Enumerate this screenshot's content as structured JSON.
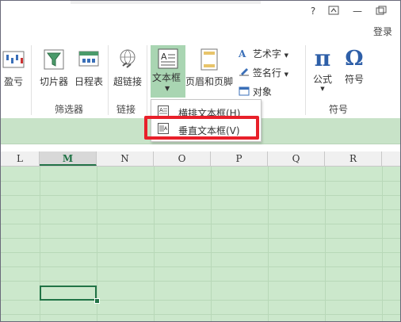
{
  "window": {
    "help_label": "?",
    "restore_label": "⧉",
    "minimize_label": "—",
    "maximize_label": "□",
    "login_label": "登录"
  },
  "ribbon": {
    "profit_label": "盈亏",
    "slicer_label": "切片器",
    "timeline_label": "日程表",
    "hyperlink_label": "超链接",
    "textbox_label": "文本框",
    "header_footer_label": "页眉和页脚",
    "wordart_label": "艺术字",
    "signature_label": "签名行",
    "object_label": "对象",
    "formula_label": "公式",
    "symbol_label": "符号",
    "group_filter": "筛选器",
    "group_link": "链接",
    "group_symbol": "符号"
  },
  "dropdown": {
    "horizontal_label": "横排文本框(H)",
    "vertical_label": "垂直文本框(V)"
  },
  "columns": [
    "L",
    "M",
    "N",
    "O",
    "P",
    "Q",
    "R"
  ],
  "colors": {
    "accent": "#217346",
    "textbox_active": "#a9d5b2",
    "sheet_bg": "#cce8cc",
    "highlight": "#e8202a"
  }
}
